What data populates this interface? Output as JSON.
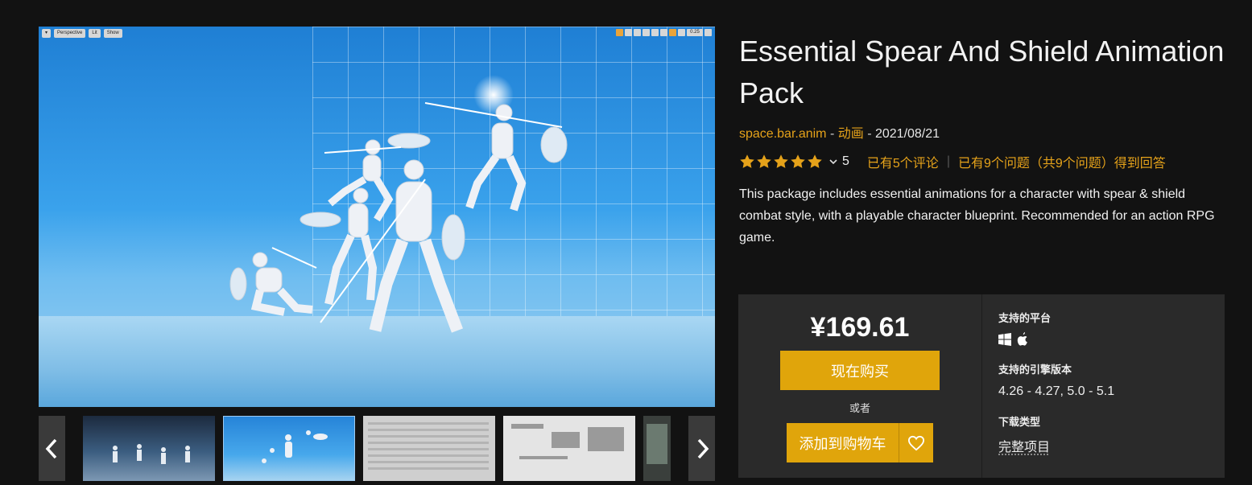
{
  "gallery": {
    "viewport_toolbar": {
      "perspective": "Perspective",
      "lit": "Lit",
      "show": "Show",
      "speed": "0.25"
    },
    "thumbnails": [
      "thumb-1",
      "thumb-2",
      "thumb-3",
      "thumb-4",
      "thumb-5"
    ],
    "prev_icon": "chevron-left-icon",
    "next_icon": "chevron-right-icon"
  },
  "product": {
    "title": "Essential Spear And Shield Animation Pack",
    "seller": "space.bar.anim",
    "meta_sep1": " - ",
    "category": "动画",
    "meta_sep2": " - ",
    "date": "2021/08/21",
    "rating": 5,
    "rating_text": "5",
    "reviews_link": "已有5个评论",
    "qa_link": "已有9个问题（共9个问题）得到回答",
    "description": "This package includes essential animations for a character with spear & shield combat style, with a playable character blueprint. Recommended for an action RPG game."
  },
  "purchase": {
    "price": "¥169.61",
    "buy_now_label": "现在购买",
    "or_label": "或者",
    "add_to_cart_label": "添加到购物车"
  },
  "specs": {
    "platforms_label": "支持的平台",
    "platforms": [
      "windows-icon",
      "apple-icon"
    ],
    "engine_label": "支持的引擎版本",
    "engine_versions": "4.26 - 4.27, 5.0 - 5.1",
    "download_type_label": "下载类型",
    "download_type": "完整项目"
  },
  "colors": {
    "accent": "#e0a50b",
    "link": "#e5a21a",
    "background": "#121212",
    "panel": "#2a2a2a"
  }
}
